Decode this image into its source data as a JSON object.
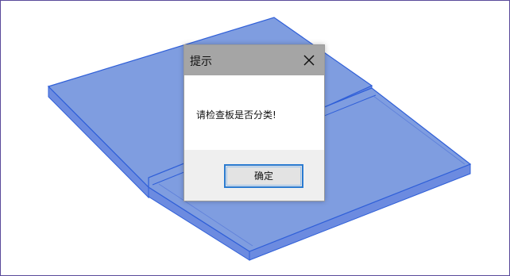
{
  "dialog": {
    "title": "提示",
    "message": "请检查板是否分类!",
    "ok_label": "确定",
    "close_icon": "close-icon"
  },
  "colors": {
    "plate_fill": "#7f9de0",
    "plate_edge": "#2f5fd8",
    "titlebar": "#a5a5a5",
    "footer": "#efefef",
    "button_border": "#2a7bd1",
    "frame_border": "#5a4a9a"
  }
}
